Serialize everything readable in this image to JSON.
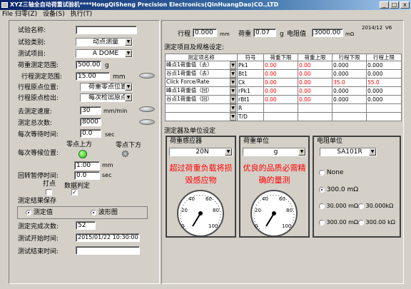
{
  "window": {
    "title": "XYZ三轴全自动荷重试验机****HongQiSheng Precision Electronics(QinHuangDao)CO.,LTD",
    "minimize": "_",
    "maximize": "□",
    "close": "x"
  },
  "menu": [
    "File 归零(Z)",
    "设备(S)",
    "执行(T)"
  ],
  "left": {
    "test_name_label": "试验名称:",
    "test_name": "",
    "test_type_label": "试验类别:",
    "test_type": "动点测量",
    "test_item_label": "测试项目:",
    "test_item": "A DOME",
    "load_range_label": "荷重测定范围:",
    "load_range": "500.00",
    "load_unit": "g",
    "travel_range_label": "行程测定范围:",
    "travel_range": "15.00",
    "travel_unit": "mm",
    "travel_origin_label": "行程原点位置:",
    "travel_origin": "荷重零点位置",
    "origin_detect_label": "行程原点检出:",
    "origin_detect": "每次检出原点",
    "speed_label": "去测定速度:",
    "speed": "30",
    "speed_unit": "mm/min",
    "total_label": "测定总次数:",
    "total": "8000",
    "wait_label": "每次等待时间:",
    "wait": "0.0",
    "wait_unit": "sec",
    "wait_pos_label": "每次等候位置:",
    "up_label": "零点上方",
    "down_label": "零点下方",
    "wait_pos": "1.00",
    "wait_pos_unit": "mm",
    "pause_label": "回转暂停时间:",
    "pause": "0.0",
    "pause_unit": "sec",
    "dot_label": "打点",
    "judge_label": "数据判定",
    "save_label": "测定结果保存",
    "save_value": "测定值",
    "save_wave": "波形图",
    "done_label": "测定完成次数:",
    "done": "52",
    "start_label": "测试开始时间:",
    "start": "2015/01/22 10:30:00",
    "end_label": "测试结束时间:",
    "end": ""
  },
  "top": {
    "travel_label": "行程",
    "travel": "0.000",
    "travel_unit": "mm",
    "load_label": "荷重",
    "load": "0.07",
    "load_unit": "g",
    "res_label": "电阻值",
    "res": "3000.00",
    "res_unit": "mΩ",
    "date": "2014/12",
    "version": "V6"
  },
  "spec": {
    "title": "测定项目及规格设定:",
    "headers": [
      "测定项名称",
      "符号",
      "荷重下限",
      "荷重上限",
      "行程下限",
      "行程上限"
    ],
    "rows": [
      {
        "name": "峰点1荷重值（去）",
        "symbol": "Pk1",
        "c1": "0.00",
        "c2": "0.00",
        "c3": "0.000",
        "c4": "0.000"
      },
      {
        "name": "谷点1荷重值（去）",
        "symbol": "Bt1",
        "c1": "0.00",
        "c2": "0.00",
        "c3": "0.000",
        "c4": "0.000"
      },
      {
        "name": "Click Force/Rate",
        "symbol": "Ck",
        "c1": "0.00",
        "c2": "0.00",
        "c3": "35.0",
        "c4": "55.0"
      },
      {
        "name": "峰点1荷重值（回）",
        "symbol": "rPk1",
        "c1": "0.00",
        "c2": "0.00",
        "c3": "0.000",
        "c4": "0.000"
      },
      {
        "name": "谷点1荷重值（回）",
        "symbol": "rBt1",
        "c1": "0.00",
        "c2": "0.00",
        "c3": "0.000",
        "c4": "0.000"
      },
      {
        "name": "",
        "symbol": "R",
        "c1": "",
        "c2": "",
        "c3": "",
        "c4": ""
      },
      {
        "name": "",
        "symbol": "T/D",
        "c1": "",
        "c2": "",
        "c3": "",
        "c4": ""
      }
    ]
  },
  "sensors": {
    "title": "测定器及单位设定",
    "load_sensor_label": "荷重感应器",
    "load_sensor": "20N",
    "warn": "超过荷重负载将损毁感应物",
    "load_unit_label": "荷重单位",
    "load_unit": "g",
    "promo": "优良的品质必需精确的量测",
    "res_unit_label": "电阻单位",
    "res_unit": "SA101R",
    "res_options": [
      "None",
      "300.0 mΩ",
      "30.000 mΩ",
      "30.000kΩ",
      "300.00 mΩ",
      "300.00 kΩ"
    ],
    "gauge1_ticks": [
      "0",
      "20",
      "40",
      "60",
      "80",
      "100"
    ],
    "gauge2_ticks": [
      "0",
      "20",
      "40",
      "60",
      "80",
      "100"
    ]
  }
}
